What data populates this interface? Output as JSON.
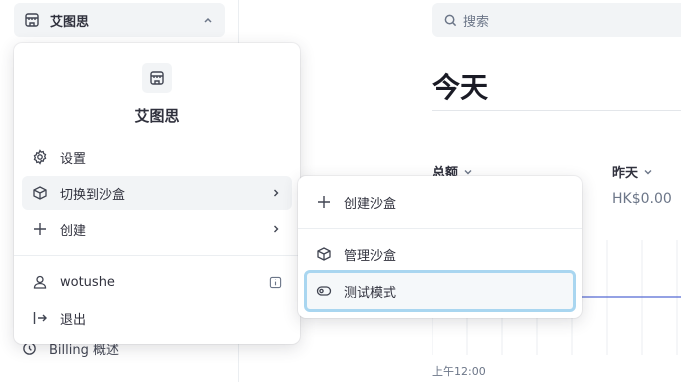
{
  "sidebar": {
    "account_name": "艾图思",
    "billing_label": "Billing 概述"
  },
  "search": {
    "placeholder": "搜索"
  },
  "main": {
    "title": "今天",
    "metrics": [
      {
        "label": "总额"
      },
      {
        "label": "昨天",
        "value": "HK$0.00"
      }
    ],
    "axis_start_label": "上午12:00"
  },
  "account_menu": {
    "account_name": "艾图思",
    "items": [
      {
        "label": "设置",
        "icon": "gear-icon"
      },
      {
        "label": "切换到沙盒",
        "icon": "cube-icon",
        "has_submenu": true
      },
      {
        "label": "创建",
        "icon": "plus-icon",
        "has_submenu": true
      },
      {
        "label": "wotushe",
        "icon": "user-icon",
        "badge_icon": "info-icon"
      },
      {
        "label": "退出",
        "icon": "logout-icon"
      }
    ]
  },
  "sandbox_submenu": {
    "items": [
      {
        "label": "创建沙盒",
        "icon": "plus-icon"
      },
      {
        "label": "管理沙盒",
        "icon": "cube-icon"
      },
      {
        "label": "测试模式",
        "icon": "toggle-icon"
      }
    ]
  },
  "colors": {
    "accent_focus_ring": "#a9d6f0",
    "chart_line": "#5469d4",
    "text_primary": "#30313d",
    "text_secondary": "#6c7688"
  }
}
